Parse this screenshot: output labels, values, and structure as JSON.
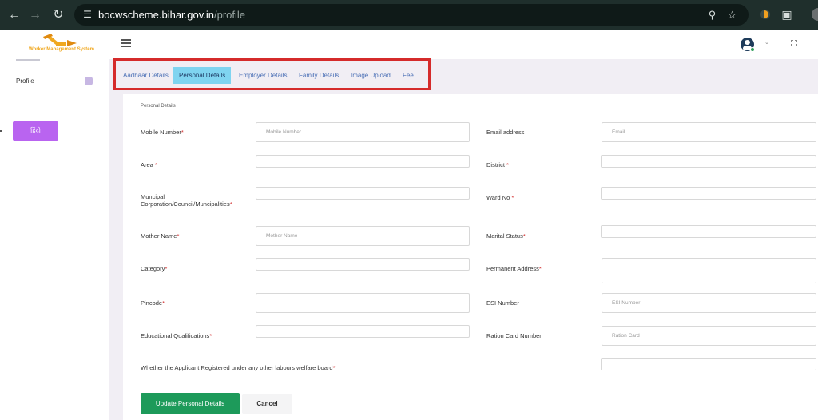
{
  "browser": {
    "url_host": "bocwscheme.bihar.gov.in",
    "url_path": "/profile"
  },
  "sidebar": {
    "logo_text": "Worker Management System",
    "profile_label": "Profile",
    "hindi_button": "हिंदी"
  },
  "tabs": [
    {
      "label": "Aadhaar Details",
      "active": false
    },
    {
      "label": "Personal Details",
      "active": true
    },
    {
      "label": "Employer Details",
      "active": false
    },
    {
      "label": "Family Details",
      "active": false
    },
    {
      "label": "Image Upload",
      "active": false
    },
    {
      "label": "Fee",
      "active": false
    }
  ],
  "form": {
    "section_title": "Personal Details",
    "fields": {
      "mobile": {
        "label": "Mobile Number",
        "placeholder": "Mobile Number",
        "required": true
      },
      "email": {
        "label": "Email address",
        "placeholder": "Email",
        "required": false
      },
      "area": {
        "label": "Area ",
        "placeholder": "",
        "required": true
      },
      "district": {
        "label": "District ",
        "placeholder": "",
        "required": true
      },
      "municipal": {
        "label": "Muncipal Corporation/Council/Muncipalities",
        "placeholder": "",
        "required": true
      },
      "ward": {
        "label": "Ward No ",
        "placeholder": "",
        "required": true
      },
      "mother": {
        "label": "Mother Name",
        "placeholder": "Mother Name",
        "required": true
      },
      "marital": {
        "label": "Marital Status",
        "placeholder": "",
        "required": true
      },
      "category": {
        "label": "Category",
        "placeholder": "",
        "required": true
      },
      "address": {
        "label": "Permanent Address",
        "placeholder": "",
        "required": true
      },
      "pincode": {
        "label": "Pincode",
        "placeholder": "",
        "required": true
      },
      "esi": {
        "label": "ESI Number",
        "placeholder": "ESI Number",
        "required": false
      },
      "education": {
        "label": "Educational Qualifications",
        "placeholder": "",
        "required": true
      },
      "ration": {
        "label": "Ration Card Number",
        "placeholder": "Ration Card",
        "required": false
      },
      "welfare": {
        "label": "Whether the Applicant Registered under any other labours welfare board",
        "placeholder": "",
        "required": true
      }
    },
    "required_mark": "*",
    "update_button": "Update Personal Details",
    "cancel_button": "Cancel"
  }
}
